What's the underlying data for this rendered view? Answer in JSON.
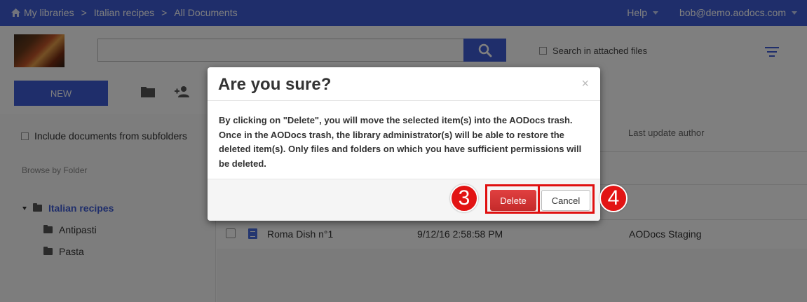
{
  "topbar": {
    "breadcrumbs": [
      "My libraries",
      "Italian recipes",
      "All Documents"
    ],
    "help_label": "Help",
    "user_label": "bob@demo.aodocs.com"
  },
  "header": {
    "search_placeholder": "",
    "search_attached_label": "Search in attached files",
    "new_button_label": "NEW"
  },
  "sidebar": {
    "include_subfolders_label": "Include documents from subfolders",
    "browse_label": "Browse by Folder",
    "tree": {
      "root": "Italian recipes",
      "children": [
        "Antipasti",
        "Pasta"
      ]
    }
  },
  "table": {
    "columns": {
      "last_update_author": "Last update author"
    },
    "rows": [
      {
        "name": "Roma Dish n°1",
        "date": "9/12/16 2:58:58 PM",
        "author": "AODocs Staging"
      }
    ]
  },
  "modal": {
    "title": "Are you sure?",
    "close_glyph": "×",
    "body": "By clicking on \"Delete\", you will move the selected item(s) into the AODocs trash. Once in the AODocs trash, the library administrator(s) will be able to restore the deleted item(s). Only files and folders on which you have sufficient permissions will be deleted.",
    "delete_label": "Delete",
    "cancel_label": "Cancel"
  },
  "annotations": {
    "step_delete": "3",
    "step_cancel": "4"
  },
  "colors": {
    "brand": "#3f5dd6",
    "danger": "#d43030",
    "annotation": "#e01010"
  }
}
